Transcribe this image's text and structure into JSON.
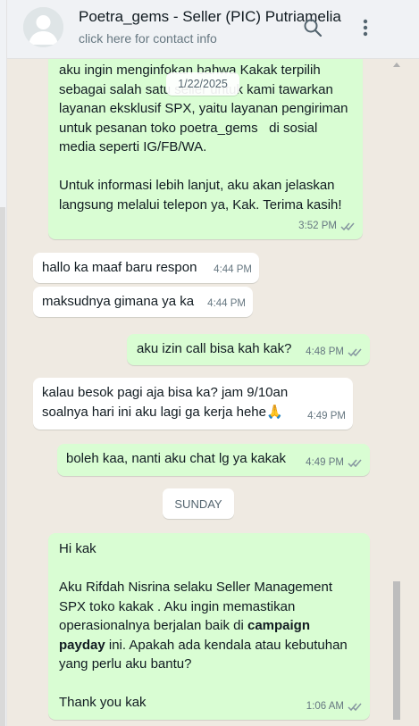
{
  "header": {
    "contact_name": "Poetra_gems - Seller (PIC) Putriamelia",
    "contact_subtitle": "click here for contact info",
    "icons": [
      "avatar-placeholder-icon",
      "search-icon",
      "more-vert-icon"
    ]
  },
  "floating_date": "1/22/2025",
  "messages": [
    {
      "direction": "out",
      "text": "aku ingin menginfokan bahwa Kakak terpilih\nsebagai salah satu seller untuk kami tawarkan\nlayanan eksklusif SPX, yaitu layanan pengiriman\nuntuk pesanan toko poetra_gems   di sosial\nmedia seperti IG/FB/WA.\n\nUntuk informasi lebih lanjut, aku akan jelaskan\nlangsung melalui telepon ya, Kak. Terima kasih!",
      "time": "3:52 PM",
      "status": "read"
    },
    {
      "direction": "in",
      "text": "hallo ka maaf baru respon",
      "time": "4:44 PM"
    },
    {
      "direction": "in",
      "text": "maksudnya gimana ya ka",
      "time": "4:44 PM"
    },
    {
      "direction": "out",
      "text": "aku izin call bisa kah kak?",
      "time": "4:48 PM",
      "status": "read"
    },
    {
      "direction": "in",
      "text": "kalau besok pagi aja bisa ka? jam 9/10an\nsoalnya hari ini aku lagi ga kerja hehe🙏",
      "time": "4:49 PM"
    },
    {
      "direction": "out",
      "text": "boleh kaa, nanti aku chat lg ya kakak",
      "time": "4:49 PM",
      "status": "read"
    },
    {
      "direction": "out",
      "parts": {
        "p1": "Hi kak\n\nAku Rifdah Nisrina selaku Seller Management\nSPX toko kakak . Aku ingin memastikan\noperasionalnya berjalan baik di ",
        "bold1": "campaign",
        "p2": "\n",
        "bold2": "payday",
        "p3": " ini. Apakah ada kendala atau kebutuhan\nyang perlu aku bantu?\n\nThank you kak"
      },
      "time": "1:06 AM",
      "status": "read"
    }
  ],
  "day_divider": "SUNDAY",
  "colors": {
    "outgoing_bubble": "#d9fdd3",
    "incoming_bubble": "#ffffff",
    "chat_background": "#efeae2",
    "read_ticks": "#8696a0"
  }
}
